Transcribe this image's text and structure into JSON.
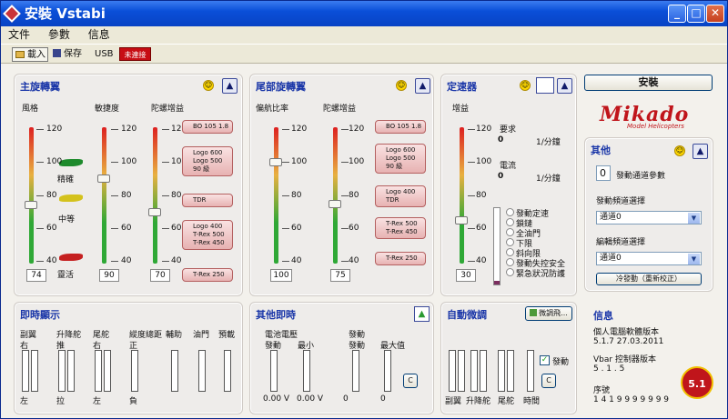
{
  "window": {
    "title": "安裝 Vstabi",
    "min": "_",
    "max": "□",
    "close": "✕"
  },
  "menu": [
    "文件",
    "參數",
    "信息"
  ],
  "toolbar": {
    "load": "載入",
    "save": "保存",
    "usb": "USB",
    "connected": "未連接"
  },
  "main_rotor": {
    "title": "主旋轉翼",
    "col1": "風格",
    "col2": "敏捷度",
    "col3": "陀螺增益",
    "styles": [
      "精確",
      "中等",
      "靈活"
    ],
    "values": [
      "74",
      "90",
      "70"
    ],
    "callouts": [
      "BO 105 1.8",
      "Logo 600\nLogo 500\n90 級",
      "TDR",
      "Logo 400\nT-Rex 500\nT-Rex 450",
      "T-Rex 250"
    ]
  },
  "ticks": [
    "120",
    "100",
    "80",
    "60",
    "40"
  ],
  "tail_rotor": {
    "title": "尾部旋轉翼",
    "col1": "偏航比率",
    "col2": "陀螺增益",
    "values": [
      "100",
      "75"
    ],
    "callouts": [
      "BO 105 1.8",
      "Logo 600\nLogo 500\n90 級",
      "Logo 400\nTDR",
      "T-Rex 500\nT-Rex 450",
      "T-Rex 250"
    ]
  },
  "governor": {
    "title": "定速器",
    "gain_label": "增益",
    "value": "30",
    "req_label": "要求",
    "req_val": "0",
    "req_unit": "1/分鐘",
    "cur_label": "電流",
    "cur_val": "0",
    "cur_unit": "1/分鐘",
    "status": [
      "發動定速",
      "鎖鏈",
      "全油門",
      "下限",
      "斜向限",
      "發動失控安全",
      "緊急狀況防護"
    ]
  },
  "install_btn": "安裝",
  "brand": {
    "name": "Mikado",
    "sub": "Model Helicopters"
  },
  "other": {
    "title": "其他",
    "count": "0",
    "count_label": "發動通道參數",
    "sel1_label": "發動頻道選擇",
    "sel1": "通道0",
    "sel2_label": "編輯頻道選擇",
    "sel2": "通道0",
    "calib_btn": "冷發動（重新校正）"
  },
  "realtime": {
    "title": "即時顯示",
    "cols": [
      "副翼",
      "升降舵",
      "尾舵",
      "縱度總距",
      "輔助",
      "油門",
      "預載"
    ],
    "tops": [
      "右",
      "推",
      "右",
      "正"
    ],
    "bottoms": [
      "左",
      "拉",
      "左",
      "負"
    ]
  },
  "other_realtime": {
    "title": "其他即時",
    "battery": "電池電壓",
    "startup": "發動",
    "min": "最小",
    "max": "最大值",
    "v1": "0.00 V",
    "v2": "0.00 V",
    "v3": "0",
    "v4": "0",
    "btn": "C"
  },
  "auto_trim": {
    "title": "自動微調",
    "fine_btn": "微調飛...",
    "cols": [
      "副翼",
      "升降舵",
      "尾舵",
      "時間"
    ],
    "checkbox": "發動",
    "btn": "C"
  },
  "info": {
    "title": "信息",
    "l1": "個人電腦軟體版本",
    "v1": "5.1.7  27.03.2011",
    "l2": "Vbar 控制器版本",
    "v2": "5 . 1 . 5",
    "l3": "序號",
    "v3": "1 4 1 9 9 9 9 9 9 9",
    "badge": "5.1"
  },
  "colors": {
    "title_blue": "#1a36a8",
    "callout_red": "#e7b2b2",
    "brand_red": "#c0151b"
  }
}
